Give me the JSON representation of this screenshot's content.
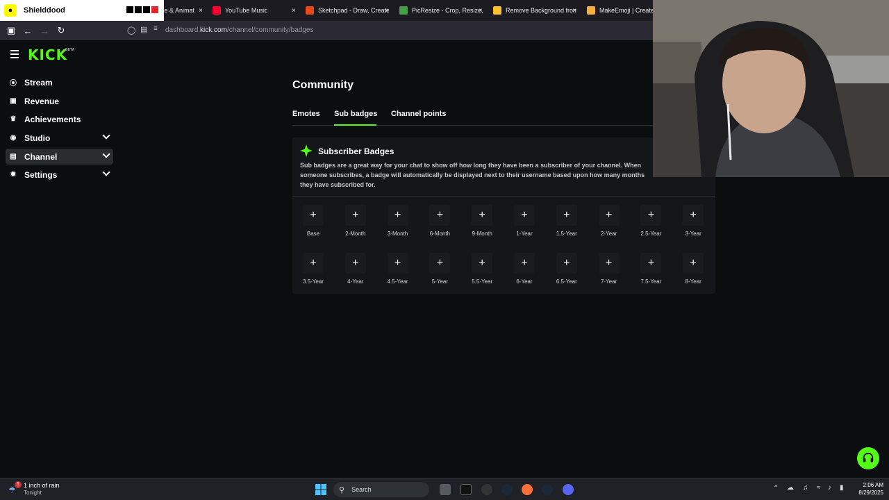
{
  "browser": {
    "profile_tab": "Shielddood",
    "tabs": [
      {
        "label": "ke & Animat",
        "color": "#3a7bd5"
      },
      {
        "label": "YouTube Music",
        "color": "#ff0033"
      },
      {
        "label": "Sketchpad - Draw, Create, S",
        "color": "#e64a19"
      },
      {
        "label": "PicResize - Crop, Resize, Ed",
        "color": "#43a047"
      },
      {
        "label": "Remove Background from I",
        "color": "#fbc02d"
      },
      {
        "label": "MakeEmoji | Create",
        "color": "#f5b041"
      }
    ],
    "url_prefix": "dashboard.",
    "url_host": "kick.com",
    "url_path": "/channel/community/badges"
  },
  "brand": {
    "logo": "KICK",
    "beta": "BETA",
    "accent": "#53fc18"
  },
  "sidebar": {
    "items": [
      {
        "label": "Stream",
        "icon": "broadcast-icon"
      },
      {
        "label": "Revenue",
        "icon": "cash-icon"
      },
      {
        "label": "Achievements",
        "icon": "trophy-icon"
      },
      {
        "label": "Studio",
        "icon": "studio-icon"
      },
      {
        "label": "Channel",
        "icon": "channel-icon"
      },
      {
        "label": "Settings",
        "icon": "gear-icon"
      }
    ]
  },
  "main": {
    "title": "Community",
    "tabs": [
      "Emotes",
      "Sub badges",
      "Channel points"
    ],
    "card_title": "Subscriber Badges",
    "description": "Sub badges are a great way for your chat to show off how long they have been a subscriber of your channel. When someone subscribes, a badge will automatically be displayed next to their username based upon how many months they have subscribed for.",
    "badges": [
      "Base",
      "2-Month",
      "3-Month",
      "6-Month",
      "9-Month",
      "1-Year",
      "1.5-Year",
      "2-Year",
      "2.5-Year",
      "3-Year",
      "3.5-Year",
      "4-Year",
      "4.5-Year",
      "5-Year",
      "5.5-Year",
      "6-Year",
      "6.5-Year",
      "7-Year",
      "7.5-Year",
      "8-Year"
    ]
  },
  "taskbar": {
    "weather_title": "1 inch of rain",
    "weather_sub": "Tonight",
    "weather_badge": "1",
    "search_placeholder": "Search",
    "time": "2:06 AM",
    "date": "8/29/2025"
  }
}
